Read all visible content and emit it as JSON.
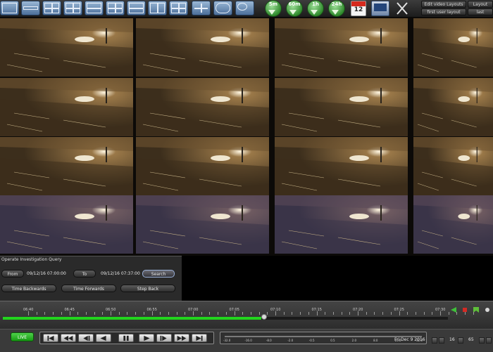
{
  "toolbar": {
    "clocks": [
      "5m",
      "60m",
      "1h",
      "24h"
    ],
    "layout_buttons": [
      "Edit video Layouts",
      "first user layout",
      "Layout",
      "last"
    ],
    "calendar_date": "12"
  },
  "query_panel": {
    "title": "Operate Investigation Query",
    "from_label": "From",
    "from_value": "09/12/16 07:00:00",
    "to_label": "To",
    "to_value": "09/12/16 07:37:00",
    "search_label": "Search",
    "time_backwards_label": "Time Backwards",
    "time_forwards_label": "Time Forwards",
    "step_back_label": "Step Back"
  },
  "timeline": {
    "labels": [
      "06:40",
      "06:45",
      "06:50",
      "06:55",
      "07:00",
      "07:05",
      "07:10",
      "07:15",
      "07:20",
      "07:25",
      "07:30"
    ],
    "progress": 0.58
  },
  "controls": {
    "live_label": "LIVE",
    "speed_labels": [
      "-32.0",
      "-16.0",
      "-8.0",
      "-2.0",
      "-0.5",
      "0.5",
      "2.0",
      "8.0",
      "16.0",
      "32.0"
    ],
    "date": "Fri Dec 9 2016",
    "speed": "16",
    "zoom": "65"
  },
  "colors": {
    "progress": "#22d41d",
    "live": "#2fbf2a",
    "toolbar_blue": "#6d8fb8"
  }
}
